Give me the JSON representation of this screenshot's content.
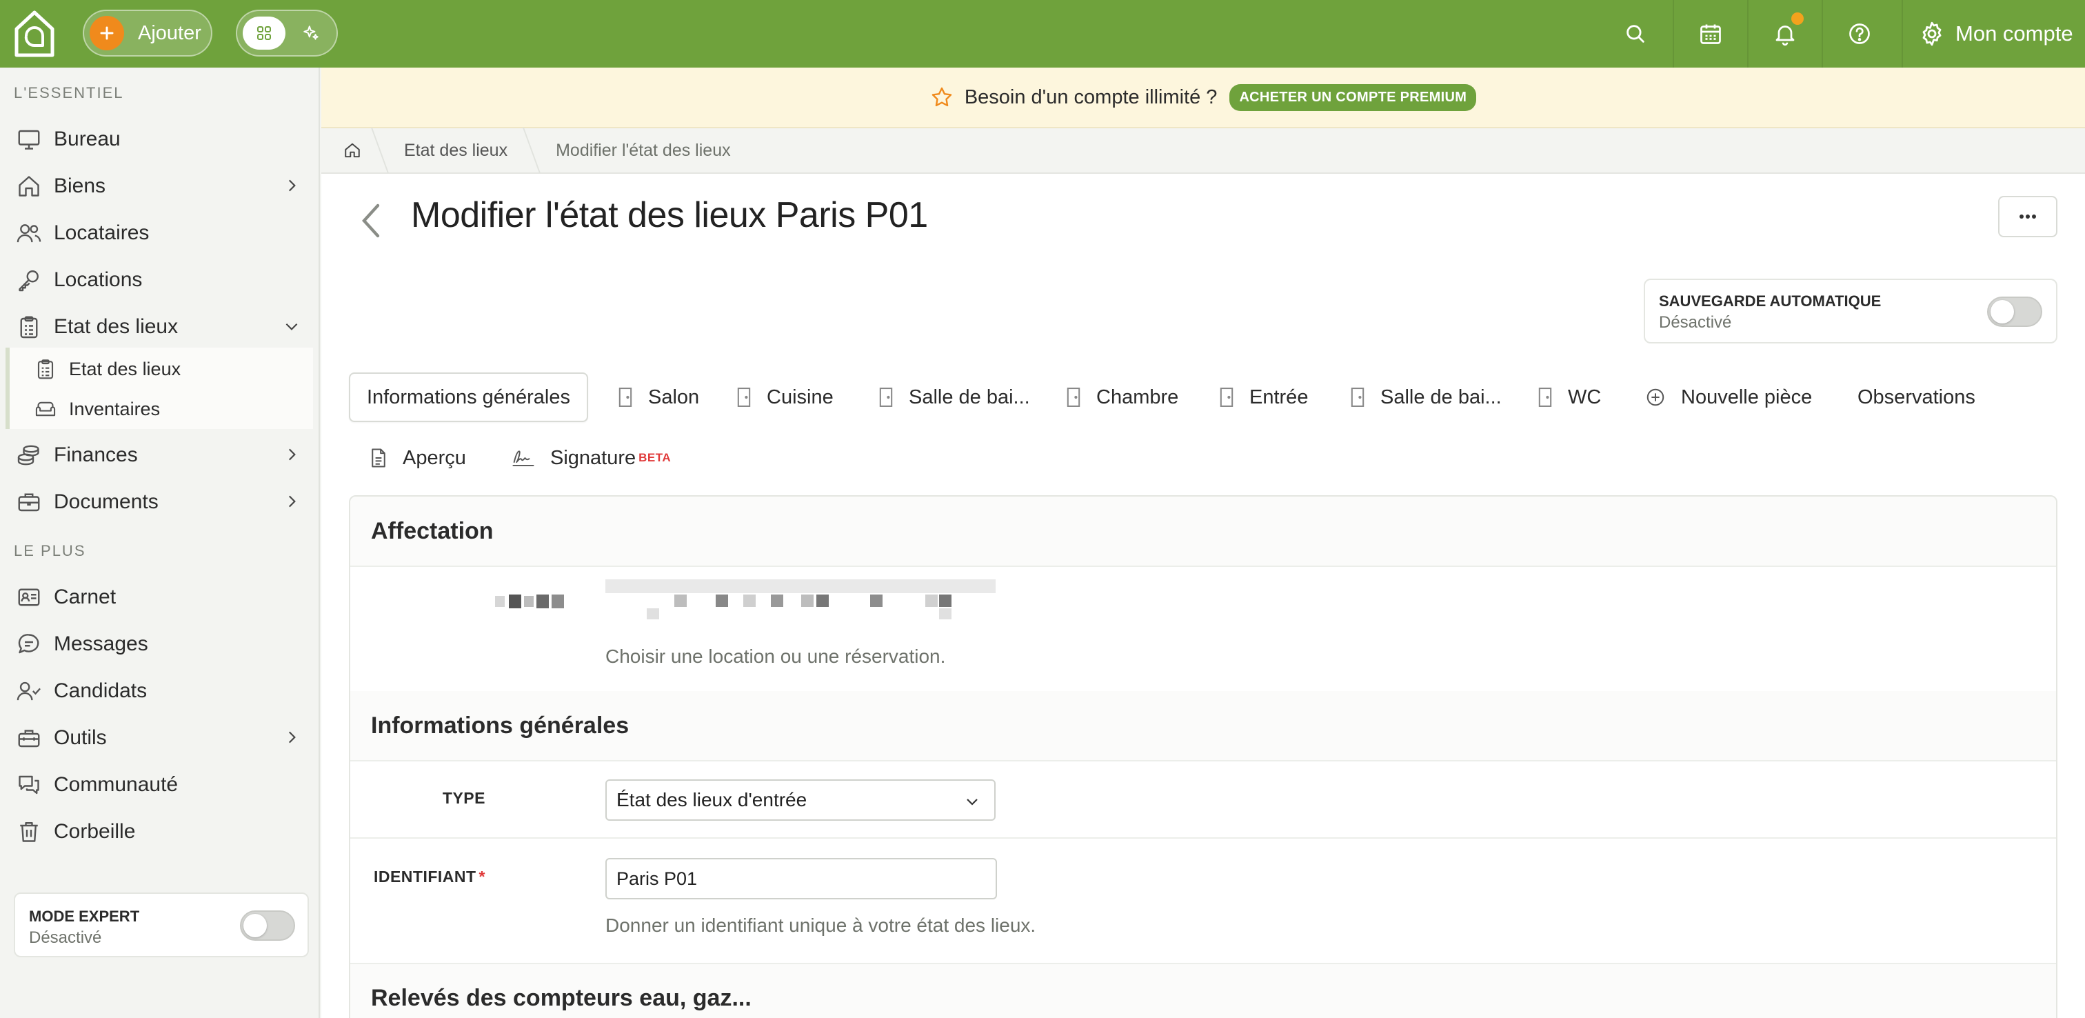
{
  "topbar": {
    "add_label": "Ajouter",
    "account_label": "Mon compte",
    "icons": [
      "home-logo-icon",
      "plus-icon",
      "grid-icon",
      "sparkles-icon",
      "search-icon",
      "calendar-icon",
      "bell-icon",
      "help-icon",
      "gear-icon"
    ],
    "colors": {
      "bar": "#6fa23c",
      "add_circle": "#f08a1c",
      "notification_dot": "#f3a21d"
    }
  },
  "sidebar": {
    "section_essentiel": "L'ESSENTIEL",
    "section_plus": "LE PLUS",
    "items": [
      {
        "label": "Bureau",
        "icon": "monitor-icon"
      },
      {
        "label": "Biens",
        "icon": "house-icon"
      },
      {
        "label": "Locataires",
        "icon": "users-icon"
      },
      {
        "label": "Locations",
        "icon": "key-icon"
      },
      {
        "label": "Etat des lieux",
        "icon": "clipboard-icon"
      },
      {
        "label": "Finances",
        "icon": "coins-icon"
      },
      {
        "label": "Documents",
        "icon": "briefcase-icon"
      }
    ],
    "sub_items": [
      {
        "label": "Etat des lieux",
        "icon": "clipboard-icon"
      },
      {
        "label": "Inventaires",
        "icon": "sofa-icon"
      }
    ],
    "plus_items": [
      {
        "label": "Carnet",
        "icon": "contact-card-icon"
      },
      {
        "label": "Messages",
        "icon": "chat-icon"
      },
      {
        "label": "Candidats",
        "icon": "user-check-icon"
      },
      {
        "label": "Outils",
        "icon": "toolbox-icon"
      },
      {
        "label": "Communauté",
        "icon": "chats-icon"
      },
      {
        "label": "Corbeille",
        "icon": "trash-icon"
      }
    ],
    "expert": {
      "title": "MODE EXPERT",
      "status": "Désactivé"
    }
  },
  "banner": {
    "text": "Besoin d'un compte illimité ?",
    "cta": "ACHETER UN COMPTE PREMIUM"
  },
  "breadcrumb": {
    "items": [
      "Etat des lieux",
      "Modifier l'état des lieux"
    ]
  },
  "page": {
    "title": "Modifier l'état des lieux Paris P01",
    "autosave": {
      "title": "SAUVEGARDE AUTOMATIQUE",
      "status": "Désactivé"
    }
  },
  "tabs": {
    "items": [
      "Informations générales",
      "Salon",
      "Cuisine",
      "Salle de bai...",
      "Chambre",
      "Entrée",
      "Salle de bai...",
      "WC",
      "Nouvelle pièce",
      "Observations",
      "Aperçu",
      "Signature"
    ],
    "beta_label": "BETA"
  },
  "form": {
    "affectation": {
      "title": "Affectation",
      "help": "Choisir une location ou une réservation."
    },
    "general": {
      "title": "Informations générales",
      "type_label": "TYPE",
      "type_value": "État des lieux d'entrée",
      "id_label": "IDENTIFIANT",
      "id_required": "*",
      "id_value": "Paris P01",
      "id_help": "Donner un identifiant unique à votre état des lieux."
    },
    "meters": {
      "title": "Relevés des compteurs eau, gaz..."
    }
  }
}
